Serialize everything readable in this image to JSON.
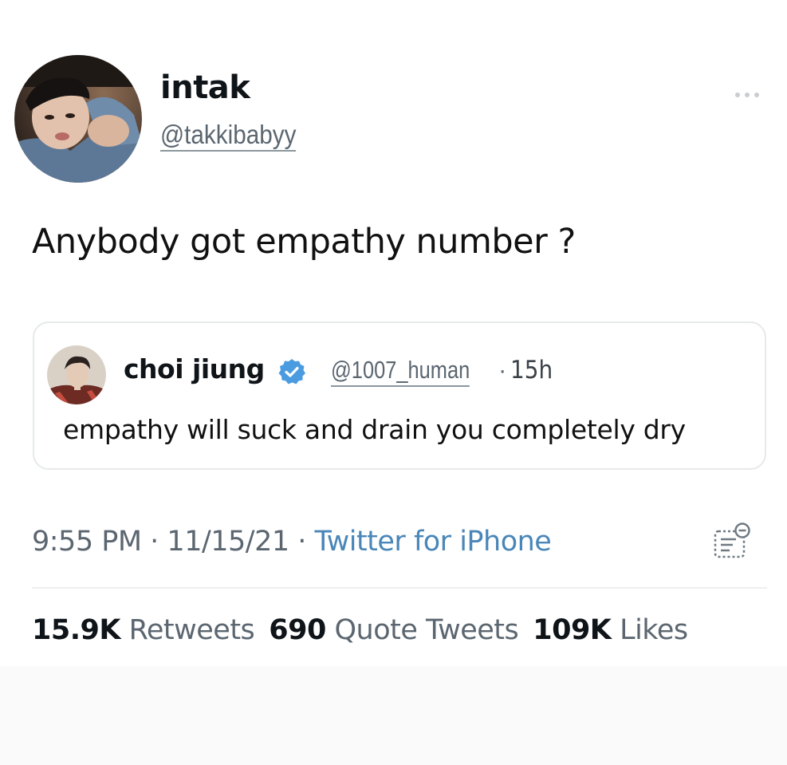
{
  "author": {
    "display_name": "intak",
    "handle": "@takkibabyy",
    "avatar_icon": "user-photo-avatar"
  },
  "more_icon": "more-horizontal-icon",
  "tweet": {
    "text": "Anybody got empathy number ?"
  },
  "quote": {
    "display_name": "choi jiung",
    "verified_icon": "verified-badge-icon",
    "handle": "@1007_human",
    "separator": "·",
    "time": "15h",
    "text": "empathy will suck and drain you completely dry"
  },
  "meta": {
    "time": "9:55 PM",
    "sep1": " · ",
    "date": "11/15/21",
    "sep2": " · ",
    "source": "Twitter for iPhone",
    "analytics_icon": "analytics-icon"
  },
  "stats": {
    "retweets_count": "15.9K",
    "retweets_label": "Retweets",
    "quotes_count": "690",
    "quotes_label": "Quote Tweets",
    "likes_count": "109K",
    "likes_label": "Likes"
  },
  "colors": {
    "link_blue": "#4a86b8",
    "verified_blue": "#4b9be0",
    "secondary_text": "#5b6670",
    "primary_text": "#0f1419"
  }
}
